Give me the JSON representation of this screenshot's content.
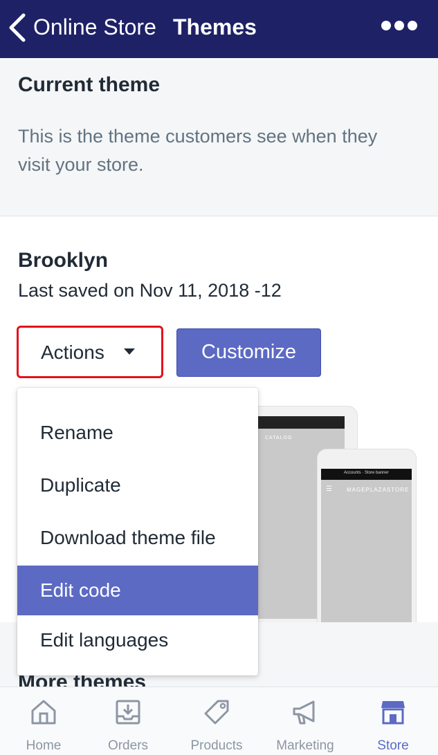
{
  "header": {
    "back_label": "Online Store",
    "title": "Themes"
  },
  "current_theme": {
    "heading": "Current theme",
    "description": "This is the theme customers see when they visit your store."
  },
  "theme": {
    "name": "Brooklyn",
    "last_saved": "Last saved on Nov 11, 2018 -12",
    "actions_label": "Actions",
    "customize_label": "Customize",
    "preview": {
      "tablet_nav": "CATALOG",
      "phone_announcement": "Accounts · Store banner",
      "phone_store_name": "MAGEPLAZASTORE"
    }
  },
  "actions_menu": {
    "items": [
      {
        "label": "Rename"
      },
      {
        "label": "Duplicate"
      },
      {
        "label": "Download theme file"
      },
      {
        "label": "Edit code"
      },
      {
        "label": "Edit languages"
      }
    ],
    "active_item": "Edit code"
  },
  "more_themes": {
    "heading": "More themes"
  },
  "tabbar": {
    "items": [
      {
        "label": "Home",
        "icon": "home-icon"
      },
      {
        "label": "Orders",
        "icon": "orders-icon"
      },
      {
        "label": "Products",
        "icon": "tag-icon"
      },
      {
        "label": "Marketing",
        "icon": "megaphone-icon"
      },
      {
        "label": "Store",
        "icon": "store-icon"
      }
    ],
    "active": "Store"
  },
  "colors": {
    "header_bg": "#1f2167",
    "accent": "#5c6ac4",
    "highlight_outline": "#e3121b",
    "tab_inactive": "#8c96a3"
  }
}
